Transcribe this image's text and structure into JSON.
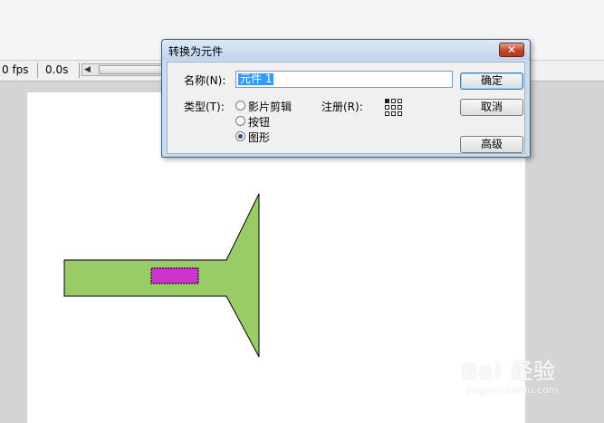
{
  "timeline": {
    "fps": "0 fps",
    "time": "0.0s"
  },
  "dialog": {
    "title": "转换为元件",
    "close_glyph": "✕",
    "name_label": "名称(N):",
    "name_value": "元件 1",
    "type_label": "类型(T):",
    "types": [
      {
        "label": "影片剪辑",
        "checked": false
      },
      {
        "label": "按钮",
        "checked": false
      },
      {
        "label": "图形",
        "checked": true
      }
    ],
    "registration_label": "注册(R):",
    "buttons": {
      "ok": "确定",
      "cancel": "取消",
      "advanced": "高级"
    }
  },
  "stage": {
    "shape_fill": "#99cc66",
    "selection_fill": "#cc33cc"
  },
  "watermark": {
    "logo": "Bai 经验",
    "url": "jingyan.baidu.com"
  }
}
